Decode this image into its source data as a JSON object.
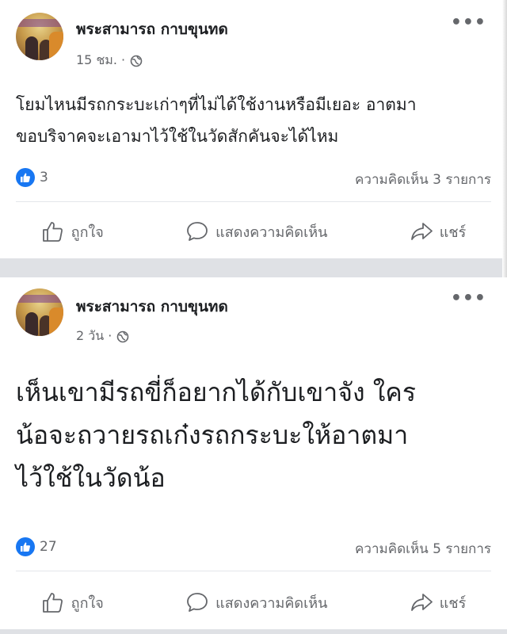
{
  "posts": [
    {
      "author": "พระสามารถ กาบขุนทด",
      "time": "15 ชม. ·",
      "more_label": "•••",
      "text_lines": [
        "โยมไหนมีรถกระบะเก่าๆที่ไม่ได้ใช้งานหรือมีเยอะ อาตมา",
        "ขอบริจาคจะเอามาไว้ใช้ในวัดสักคันจะได้ไหม"
      ],
      "reaction_icon": "like-icon",
      "reaction_count": "3",
      "comments_label": "ความคิดเห็น 3 รายการ",
      "actions": {
        "like": "ถูกใจ",
        "comment": "แสดงความคิดเห็น",
        "share": "แชร์"
      }
    },
    {
      "author": "พระสามารถ กาบขุนทด",
      "time": "2 วัน ·",
      "more_label": "•••",
      "text_lines": [
        "เห็นเขามีรถขี่ก็อยากได้กับเขาจัง ใคร",
        "น้อจะถวายรถเก๋งรถกระบะให้อาตมา",
        "ไว้ใช้ในวัดน้อ"
      ],
      "reaction_icon": "like-icon",
      "reaction_count": "27",
      "comments_label": "ความคิดเห็น 5 รายการ",
      "actions": {
        "like": "ถูกใจ",
        "comment": "แสดงความคิดเห็น",
        "share": "แชร์"
      }
    }
  ],
  "colors": {
    "brand_blue": "#1877f2",
    "secondary_text": "#65676b",
    "separator": "#dfe1e5"
  }
}
